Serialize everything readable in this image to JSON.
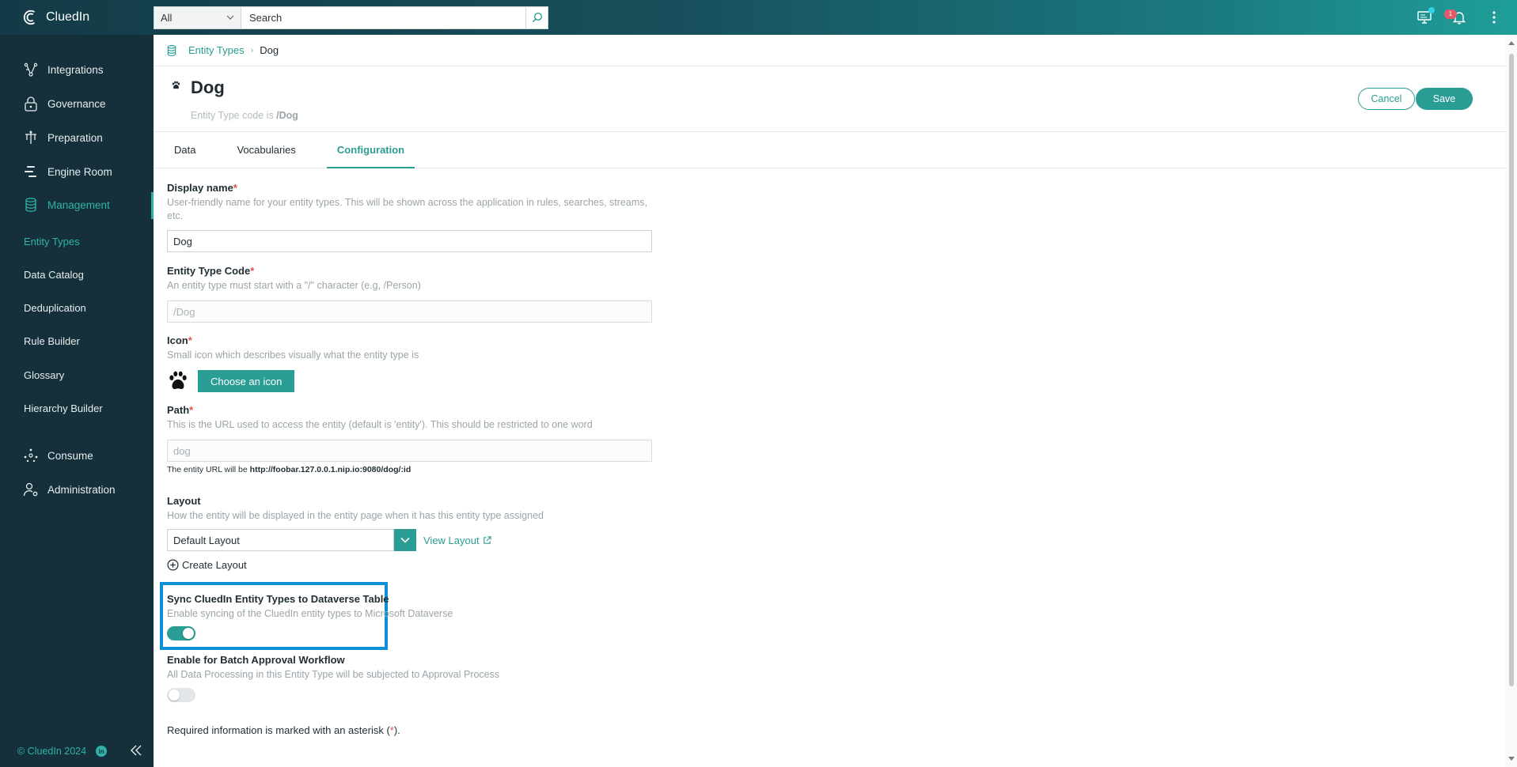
{
  "app": {
    "name": "CluedIn"
  },
  "search": {
    "scope": "All",
    "placeholder": "Search"
  },
  "topbar": {
    "notification_count": "1"
  },
  "sidebar": {
    "items": [
      {
        "label": "Integrations"
      },
      {
        "label": "Governance"
      },
      {
        "label": "Preparation"
      },
      {
        "label": "Engine Room"
      },
      {
        "label": "Management"
      },
      {
        "label": "Consume"
      },
      {
        "label": "Administration"
      }
    ],
    "management_sub": [
      {
        "label": "Entity Types"
      },
      {
        "label": "Data Catalog"
      },
      {
        "label": "Deduplication"
      },
      {
        "label": "Rule Builder"
      },
      {
        "label": "Glossary"
      },
      {
        "label": "Hierarchy Builder"
      }
    ],
    "footer": {
      "copyright": "© CluedIn 2024",
      "linkedin": "in"
    }
  },
  "breadcrumb": {
    "parent": "Entity Types",
    "current": "Dog"
  },
  "header": {
    "title": "Dog",
    "subtitle_prefix": "Entity Type code is ",
    "subtitle_code": "/Dog",
    "cancel_label": "Cancel",
    "save_label": "Save"
  },
  "tabs": [
    {
      "label": "Data"
    },
    {
      "label": "Vocabularies"
    },
    {
      "label": "Configuration"
    }
  ],
  "form": {
    "display_name": {
      "label": "Display name",
      "required": "*",
      "help": "User-friendly name for your entity types. This will be shown across the application in rules, searches, streams, etc.",
      "value": "Dog"
    },
    "entity_type_code": {
      "label": "Entity Type Code",
      "required": "*",
      "help": "An entity type must start with a \"/\" character (e.g, /Person)",
      "value": "/Dog"
    },
    "icon": {
      "label": "Icon",
      "required": "*",
      "help": "Small icon which describes visually what the entity type is",
      "button": "Choose an icon"
    },
    "path": {
      "label": "Path",
      "required": "*",
      "help": "This is the URL used to access the entity (default is 'entity'). This should be restricted to one word",
      "value": "dog",
      "url_prefix": "The entity URL will be ",
      "url": "http://foobar.127.0.0.1.nip.io:9080/dog/:id"
    },
    "layout": {
      "label": "Layout",
      "help": "How the entity will be displayed in the entity page when it has this entity type assigned",
      "value": "Default Layout",
      "view_link": "View Layout",
      "create_link": "Create Layout"
    },
    "sync": {
      "label": "Sync CluedIn Entity Types to Dataverse Table",
      "help": "Enable syncing of the CluedIn entity types to Microsoft Dataverse",
      "enabled": true
    },
    "batch": {
      "label": "Enable for Batch Approval Workflow",
      "help": "All Data Processing in this Entity Type will be subjected to Approval Process",
      "enabled": false
    },
    "required_note_prefix": "Required information is marked with an asterisk (",
    "required_note_star": "*",
    "required_note_suffix": ")."
  },
  "colors": {
    "accent": "#2a9d94",
    "sidebar_bg": "#15303a",
    "highlight": "#0d8fd6",
    "required": "#d9534f"
  }
}
